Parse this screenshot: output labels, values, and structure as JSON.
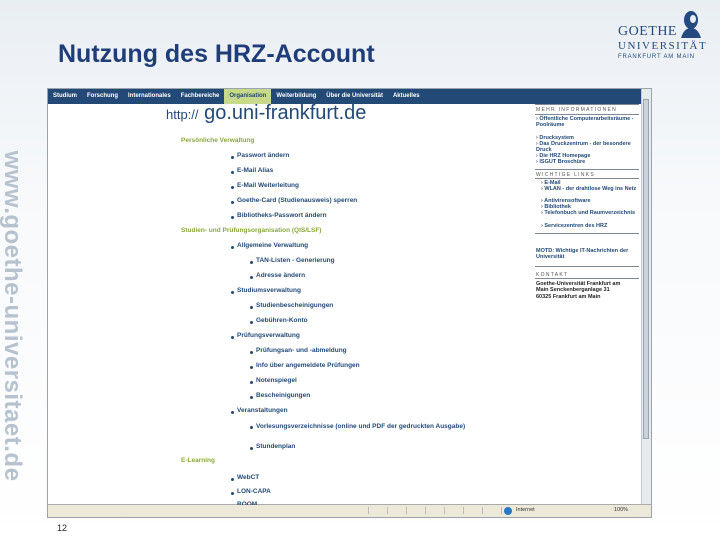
{
  "slide": {
    "title": "Nutzung des HRZ-Account",
    "side_url": "www.goethe-universitaet.de",
    "page_number": "12"
  },
  "logo": {
    "line1": "GOETHE",
    "line2": "UNIVERSITÄT",
    "line3": "FRANKFURT AM MAIN"
  },
  "screenshot": {
    "nav": [
      {
        "label": "Studium"
      },
      {
        "label": "Forschung"
      },
      {
        "label": "Internationales"
      },
      {
        "label": "Fachbereiche"
      },
      {
        "label": "Organisation"
      },
      {
        "label": "Weiterbildung"
      },
      {
        "label": "Über die Universität"
      },
      {
        "label": "Aktuelles"
      }
    ],
    "active_tab": "Organisation",
    "url_banner": {
      "proto": "http://",
      "host": "go.uni-frankfurt.de"
    },
    "sections": {
      "personal": "Persönliche Verwaltung",
      "studies": "Studien- und Prüfungsorganisation (QIS/LSF)",
      "elearning": "E-Learning"
    },
    "personal_items": [
      "Passwort ändern",
      "E-Mail Alias",
      "E-Mail Weiterleitung",
      "Goethe-Card (Studienausweis) sperren",
      "Bibliotheks-Passwort ändern"
    ],
    "studies_items": {
      "general": "Allgemeine Verwaltung",
      "tan": "TAN-Listen - Generierung",
      "address": "Adresse ändern",
      "admin": "Studiumsverwaltung",
      "certs": "Studienbescheinigungen",
      "fees": "Gebühren-Konto",
      "exam": "Prüfungsverwaltung",
      "exam_reg": "Prüfungsan- und -abmeldung",
      "exam_info": "Info über angemeldete Prüfungen",
      "grades": "Notenspiegel",
      "exam_certs": "Bescheinigungen",
      "events": "Veranstaltungen",
      "catalog": "Vorlesungsverzeichnisse (online und PDF der gedruckten Ausgabe)",
      "timetable": "Stundenplan"
    },
    "elearning_items": [
      "WebCT",
      "LON-CAPA",
      "ROOM"
    ],
    "right": {
      "more_head": "MEHR INFORMATIONEN",
      "more_items": [
        "Öffentliche Computerarbeitsräume - Poolräume",
        "Drucksystem",
        "Das Druckzentrum - der besondere Druck",
        "Die HRZ Homepage",
        "ISGUT Broschüre"
      ],
      "links_head": "WICHTIGE LINKS",
      "links_items": [
        "E-Mail",
        "WLAN - der drahtlose Weg ins Netz",
        "Antivirensoftware",
        "Bibliothek",
        "Telefonbuch und Raumverzeichnis",
        "Servicezentren des HRZ"
      ],
      "motd": "MOTD: Wichtige IT-Nachrichten der Universität",
      "contact_head": "KONTAKT",
      "contact": "Goethe-Universität Frankfurt am Main Senckenberganlage 31 60325 Frankfurt am Main"
    },
    "status": {
      "zone": "Internet",
      "zoom": "100%"
    }
  }
}
